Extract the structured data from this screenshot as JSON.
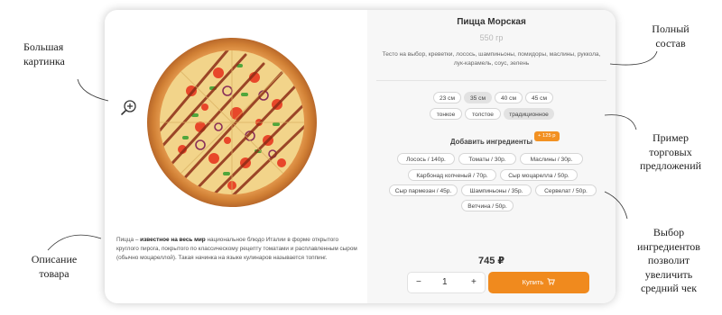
{
  "product": {
    "title": "Пицца Морская",
    "weight": "550 гр",
    "composition": "Тесто на выбор, креветки, лосось, шампиньоны, помидоры, маслины, руккола, лук-карамель, соус, зелень",
    "description_prefix": "Пицца – ",
    "description_bold": "известное на весь мир",
    "description_rest": " национальное блюдо Италии в форме открытого круглого пирога, покрытого по классическому рецепту томатами и расплавленным сыром (обычно моцареллой). Такая начинка на языке кулинаров называется топпинг.",
    "price": "745 ₽"
  },
  "sizes": [
    "23 см",
    "35 см",
    "40 см",
    "45 см"
  ],
  "sizes_selected": "35 см",
  "dough": [
    "тонкое",
    "толстое",
    "традиционное"
  ],
  "dough_selected": "традиционное",
  "ingredients_title": "Добавить ингредиенты",
  "ingredients_badge": "+ 125 р",
  "ingredients": [
    "Лосось / 140р.",
    "Томаты / 30р.",
    "Маслины / 30р.",
    "Карбонад копченый / 70р.",
    "Сыр моцарелла / 50р.",
    "Сыр пармезан / 45р.",
    "Шампиньоны / 35р.",
    "Сервелат / 50р.",
    "Ветчина / 50р."
  ],
  "stepper": {
    "minus": "−",
    "value": "1",
    "plus": "+"
  },
  "buy_label": "Купить",
  "annotations": {
    "big_picture": [
      "Большая",
      "картинка"
    ],
    "description": [
      "Описание",
      "товара"
    ],
    "full_composition": [
      "Полный",
      "состав"
    ],
    "offers": [
      "Пример",
      "торговых",
      "предложений"
    ],
    "ingredients": [
      "Выбор",
      "ингредиентов",
      "позволит",
      "увеличить",
      "средний чек"
    ]
  },
  "colors": {
    "accent": "#f08a1e",
    "badge": "#f29122",
    "panel": "#f7f7f7"
  },
  "icons": {
    "zoom": "zoom-in-icon",
    "cart": "cart-icon"
  }
}
